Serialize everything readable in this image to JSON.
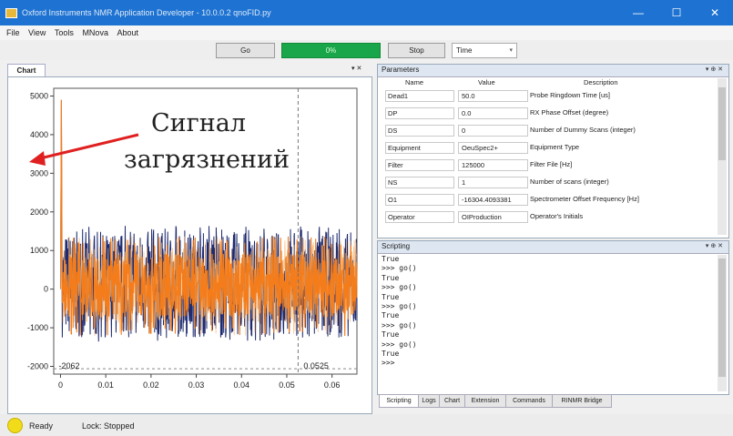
{
  "window": {
    "title": "Oxford Instruments NMR Application Developer - 10.0.0.2 qnoFID.py",
    "minimize": "—",
    "maximize": "☐",
    "close": "✕"
  },
  "menu": [
    "File",
    "View",
    "Tools",
    "MNova",
    "About"
  ],
  "toolbar": {
    "go_label": "Go",
    "progress_label": "0%",
    "progress_fraction": 1.0,
    "stop_label": "Stop",
    "view_select": "Time"
  },
  "chart_panel": {
    "tab_label": "Chart",
    "pin": "▾ ✕"
  },
  "chart_data": {
    "type": "line",
    "xlim": [
      -0.0015,
      0.0655
    ],
    "ylim": [
      -2200,
      5200
    ],
    "x_ticks": [
      0,
      0.01,
      0.02,
      0.03,
      0.04,
      0.05,
      0.06
    ],
    "x_tick_labels": [
      "0",
      "0.01",
      "0.02",
      "0.03",
      "0.04",
      "0.05",
      "0.06"
    ],
    "y_ticks": [
      -2000,
      -1000,
      0,
      1000,
      2000,
      3000,
      4000,
      5000
    ],
    "y_tick_labels": [
      "-2000",
      "-1000",
      "0",
      "1000",
      "2000",
      "3000",
      "4000",
      "5000"
    ],
    "series": [
      {
        "color": "#1f2b6e",
        "spike": 4900,
        "noise_band": [
          -1250,
          1500
        ]
      },
      {
        "color": "#f47c1a",
        "spike": 4900,
        "noise_band": [
          -1100,
          1250
        ]
      }
    ],
    "cursor_x": 0.0525,
    "cursor_x_label": "0.0525",
    "min_y_label": "-2062",
    "colors": {
      "blue": "#1f2b6e",
      "orange": "#f47c1a",
      "light_orange": "#f7b26a",
      "cursor": "#777777"
    }
  },
  "annotation": {
    "line1": "Сигнал",
    "line2": "загрязнений",
    "arrow_color": "#e02020"
  },
  "parameters": {
    "title": "Parameters",
    "controls": "▾ ⊕ ✕",
    "headers": [
      "Name",
      "Value",
      "Description"
    ],
    "rows": [
      {
        "name": "Dead1",
        "value": "50.0",
        "desc": "Probe Ringdown Time [us]"
      },
      {
        "name": "DP",
        "value": "0.0",
        "desc": "RX Phase Offset (degree)"
      },
      {
        "name": "DS",
        "value": "0",
        "desc": "Number of Dummy Scans (integer)"
      },
      {
        "name": "Equipment",
        "value": "OeuSpec2+",
        "desc": "Equipment Type"
      },
      {
        "name": "Filter",
        "value": "125000",
        "desc": "Filter File [Hz]"
      },
      {
        "name": "NS",
        "value": "1",
        "desc": "Number of scans (integer)"
      },
      {
        "name": "O1",
        "value": "-16304.4093381",
        "desc": "Spectrometer Offset Frequency [Hz]"
      },
      {
        "name": "Operator",
        "value": "OIProduction",
        "desc": "Operator's Initials"
      }
    ]
  },
  "scripting": {
    "title": "Scripting",
    "controls": "▾ ⊕ ✕",
    "lines": [
      "True",
      ">>> go()",
      "True",
      ">>> go()",
      "True",
      ">>> go()",
      "True",
      ">>> go()",
      "True",
      ">>> go()",
      "True",
      ">>>"
    ]
  },
  "bottom_tabs": [
    "Scripting",
    "Logs",
    "Chart",
    "Extension",
    "Commands",
    "RINMR Bridge"
  ],
  "status": {
    "ready": "Ready",
    "lock": "Lock: Stopped",
    "led_color": "#f2dc1a"
  }
}
